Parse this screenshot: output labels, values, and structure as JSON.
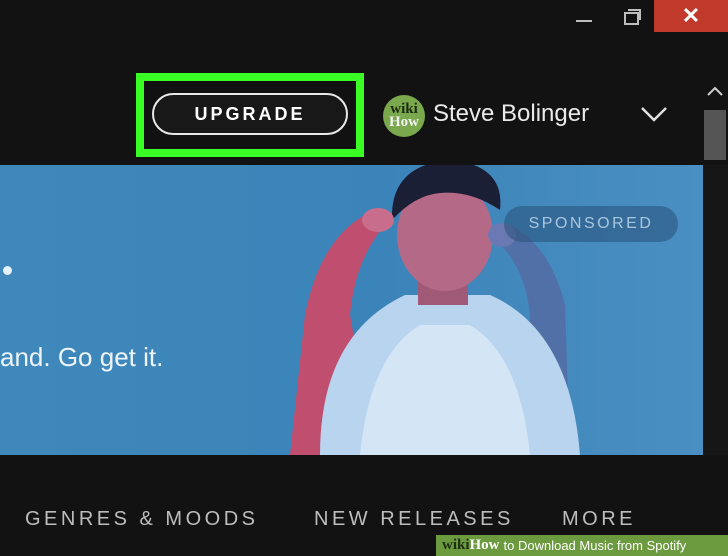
{
  "window": {
    "controls": {
      "minimize_icon": "minimize-icon",
      "maximize_icon": "maximize-icon",
      "close_icon": "close-icon",
      "close_symbol": "✕"
    }
  },
  "header": {
    "upgrade_label": "UPGRADE",
    "highlight_color": "#39ff25",
    "user": {
      "name": "Steve Bolinger",
      "avatar_line1": "wiki",
      "avatar_line2": "How"
    }
  },
  "banner": {
    "badge": "SPONSORED",
    "tagline": "and. Go get it.",
    "background_color": "#3f88bb"
  },
  "nav": {
    "items": [
      "GENRES & MOODS",
      "NEW RELEASES",
      "MORE"
    ]
  },
  "watermark": {
    "brand_wiki": "wiki",
    "brand_how": "How",
    "text": "to Download Music from Spotify"
  }
}
